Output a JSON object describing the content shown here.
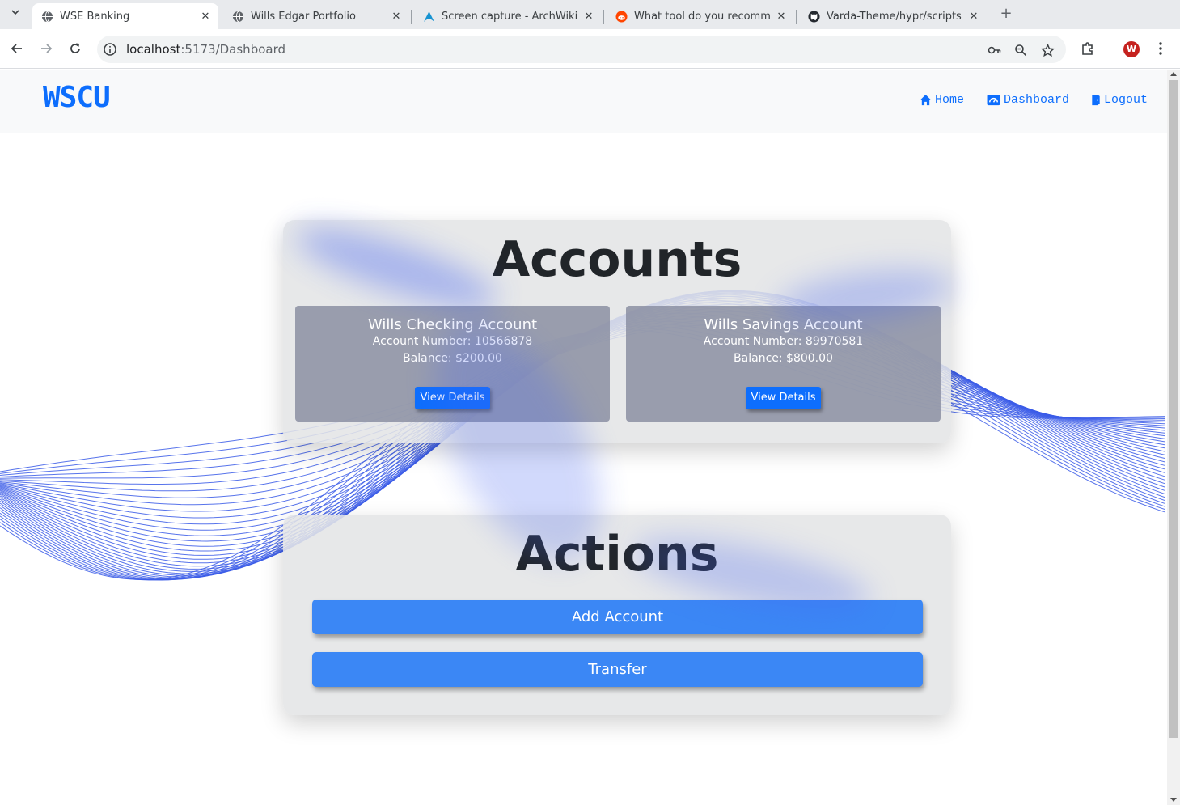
{
  "browser": {
    "tabs": [
      {
        "title": "WSE Banking",
        "active": true,
        "icon": "globe-icon"
      },
      {
        "title": "Wills Edgar Portfolio",
        "active": false,
        "icon": "globe-icon"
      },
      {
        "title": "Screen capture - ArchWiki",
        "active": false,
        "icon": "archlinux-icon"
      },
      {
        "title": "What tool do you recomm",
        "active": false,
        "icon": "reddit-icon"
      },
      {
        "title": "Varda-Theme/hypr/scripts",
        "active": false,
        "icon": "github-icon"
      }
    ],
    "url_host": "localhost",
    "url_path": ":5173/Dashboard",
    "profile_initial": "W",
    "accent_color": "#c5221f"
  },
  "site": {
    "brand": "WSCU",
    "nav": {
      "home": "Home",
      "dashboard": "Dashboard",
      "logout": "Logout"
    },
    "brand_color": "#0d6efd"
  },
  "accounts_panel": {
    "title": "Accounts",
    "accounts": [
      {
        "name": "Wills Checking Account",
        "number_text": "Account Number: 10566878",
        "balance_text": "Balance: $200.00",
        "button": "View Details"
      },
      {
        "name": "Wills Savings Account",
        "number_text": "Account Number: 89970581",
        "balance_text": "Balance: $800.00",
        "button": "View Details"
      }
    ]
  },
  "actions_panel": {
    "title": "Actions",
    "add_account": "Add Account",
    "transfer": "Transfer"
  }
}
